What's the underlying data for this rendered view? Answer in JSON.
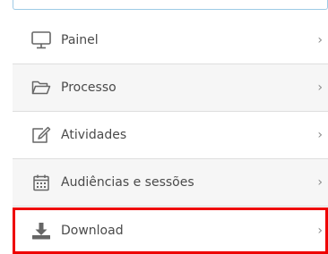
{
  "menu": {
    "items": [
      {
        "label": "Painel",
        "icon": "monitor-icon",
        "chevron": "›"
      },
      {
        "label": "Processo",
        "icon": "folder-open-icon",
        "chevron": "›"
      },
      {
        "label": "Atividades",
        "icon": "edit-icon",
        "chevron": "›"
      },
      {
        "label": "Audiências e sessões",
        "icon": "calendar-icon",
        "chevron": "›"
      },
      {
        "label": "Download",
        "icon": "download-icon",
        "chevron": "›"
      }
    ]
  },
  "colors": {
    "highlight_border": "#ee0000",
    "top_strip_border": "#9ecbe6",
    "text": "#4a4a4a",
    "icon": "#666666"
  }
}
